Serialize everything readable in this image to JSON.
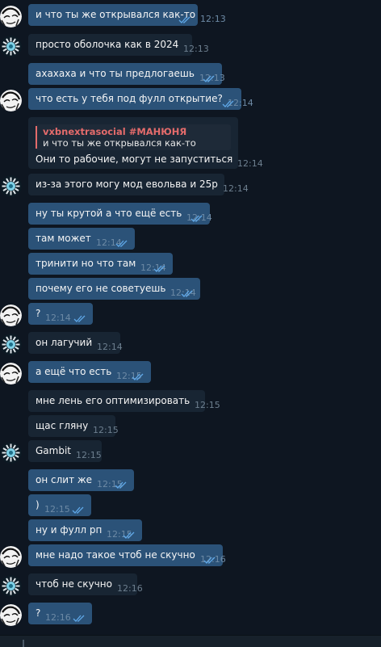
{
  "colors": {
    "background": "#0e1621",
    "outgoing_bubble": "#2b5278",
    "incoming_bubble": "#182533",
    "reply_accent": "#e46b6b",
    "read_check": "#5fa8e8"
  },
  "messages": [
    {
      "side": "out",
      "avatar": "sketch",
      "text": "и что ты же открывался как-то",
      "time": "12:13",
      "read": true
    },
    {
      "side": "in",
      "avatar": "sun",
      "text": "просто оболочка как в 2024",
      "time": "12:13"
    },
    {
      "side": "out",
      "avatar": "none",
      "text": "ахахаха и что ты предлогаешь",
      "time": "12:13",
      "read": true
    },
    {
      "side": "out",
      "avatar": "sketch",
      "text": "что есть у тебя под фулл открытие?",
      "time": "12:14",
      "read": true
    },
    {
      "side": "in",
      "avatar": "none",
      "reply_author": "vxbnextrasocial #МАНЮНЯ",
      "reply_text": "и что ты же открывался как-то",
      "text": "Они то рабочие, могут не запуститься",
      "time": "12:14"
    },
    {
      "side": "in",
      "avatar": "sun",
      "text": "из-за этого могу мод евольва и 25р",
      "time": "12:14"
    },
    {
      "side": "out",
      "avatar": "none",
      "text": "ну ты крутой а что ещё есть",
      "time": "12:14",
      "read": true
    },
    {
      "side": "out",
      "avatar": "none",
      "text": "там может",
      "time": "12:14",
      "read": true
    },
    {
      "side": "out",
      "avatar": "none",
      "text": "тринити но что там",
      "time": "12:14",
      "read": true
    },
    {
      "side": "out",
      "avatar": "none",
      "text": "почему его не советуешь",
      "time": "12:14",
      "read": true
    },
    {
      "side": "out",
      "avatar": "sketch",
      "text": "?",
      "time": "12:14",
      "read": true
    },
    {
      "side": "in",
      "avatar": "sun",
      "text": "он лагучий",
      "time": "12:14"
    },
    {
      "side": "out",
      "avatar": "sketch",
      "text": "а ещё что есть",
      "time": "12:15",
      "read": true
    },
    {
      "side": "in",
      "avatar": "none",
      "text": "мне лень его оптимизировать",
      "time": "12:15"
    },
    {
      "side": "in",
      "avatar": "none",
      "text": "щас гляну",
      "time": "12:15"
    },
    {
      "side": "in",
      "avatar": "sun",
      "text": "Gambit",
      "time": "12:15"
    },
    {
      "side": "out",
      "avatar": "none",
      "text": "он слит же",
      "time": "12:15",
      "read": true
    },
    {
      "side": "out",
      "avatar": "none",
      "text": ")",
      "time": "12:15",
      "read": true
    },
    {
      "side": "out",
      "avatar": "none",
      "text": "ну и фулл рп",
      "time": "12:15",
      "read": true
    },
    {
      "side": "out",
      "avatar": "sketch",
      "text": "мне надо такое чтоб не скучно",
      "time": "12:16",
      "read": true
    },
    {
      "side": "in",
      "avatar": "sun",
      "text": "чтоб не скучно",
      "time": "12:16"
    },
    {
      "side": "out",
      "avatar": "sketch",
      "text": "?",
      "time": "12:16",
      "read": true
    }
  ]
}
